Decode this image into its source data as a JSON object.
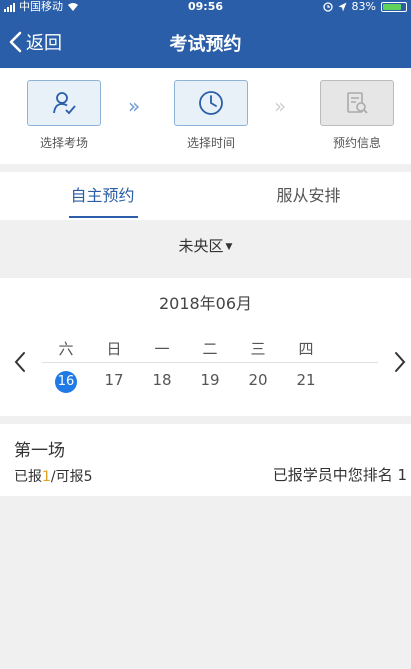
{
  "status_bar": {
    "carrier": "中国移动",
    "time": "09:56",
    "battery_percent": "83%",
    "battery_level": 0.83
  },
  "nav": {
    "back_label": "返回",
    "title": "考试预约"
  },
  "steps": [
    {
      "label": "选择考场",
      "icon": "user-check-icon",
      "state": "done"
    },
    {
      "label": "选择时间",
      "icon": "clock-icon",
      "state": "active"
    },
    {
      "label": "预约信息",
      "icon": "document-search-icon",
      "state": "disabled"
    }
  ],
  "tabs": [
    {
      "label": "自主预约",
      "active": true
    },
    {
      "label": "服从安排",
      "active": false
    }
  ],
  "district": {
    "label": "未央区"
  },
  "calendar": {
    "month": "2018年06月",
    "weekdays": [
      "六",
      "日",
      "一",
      "二",
      "三",
      "四"
    ],
    "dates": [
      "16",
      "17",
      "18",
      "19",
      "20",
      "21"
    ],
    "selected": "16"
  },
  "session": {
    "title": "第一场",
    "reported_prefix": "已报",
    "reported_count": "1",
    "capacity_text": "/可报5",
    "rank_text": "已报学员中您排名 1"
  },
  "colors": {
    "primary": "#2a5ea8",
    "selected_date": "#1f7ae6",
    "highlight": "#e0a020"
  }
}
